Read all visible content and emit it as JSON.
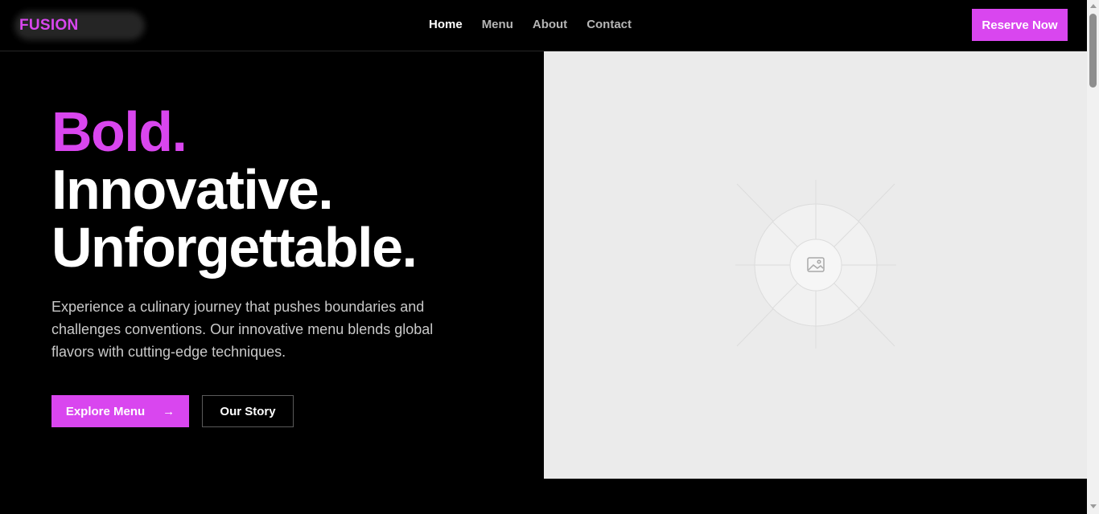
{
  "nav": {
    "logo": "FUSION",
    "links": [
      {
        "label": "Home",
        "active": true
      },
      {
        "label": "Menu",
        "active": false
      },
      {
        "label": "About",
        "active": false
      },
      {
        "label": "Contact",
        "active": false
      }
    ],
    "cta_label": "Reserve Now"
  },
  "hero": {
    "headline": [
      "Bold.",
      "Innovative.",
      "Unforgettable."
    ],
    "description": "Experience a culinary journey that pushes boundaries and challenges conventions. Our innovative menu blends global flavors with cutting-edge techniques.",
    "primary_button": "Explore Menu",
    "primary_button_icon": "arrow-right-icon",
    "secondary_button": "Our Story",
    "image_icon": "image-placeholder-icon"
  },
  "colors": {
    "accent": "#d946ef",
    "background": "#000000",
    "placeholder": "#ebebeb"
  }
}
